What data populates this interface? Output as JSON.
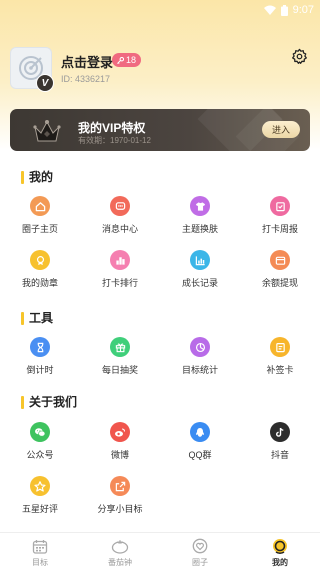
{
  "status_bar": {
    "time": "9:07"
  },
  "profile": {
    "login_label": "点击登录",
    "level": "18",
    "user_id": "ID: 4336217",
    "badge_letter": "V"
  },
  "vip": {
    "title": "我的VIP特权",
    "expiry": "有效期：1970-01-12",
    "enter_label": "进入"
  },
  "sections": {
    "mine": {
      "title": "我的",
      "items": [
        {
          "label": "圈子主页",
          "color": "#f39a55"
        },
        {
          "label": "消息中心",
          "color": "#f26a5a"
        },
        {
          "label": "主题换肤",
          "color": "#c06de6"
        },
        {
          "label": "打卡周报",
          "color": "#ef6aa0"
        },
        {
          "label": "我的勋章",
          "color": "#f7c12f"
        },
        {
          "label": "打卡排行",
          "color": "#f57fb0"
        },
        {
          "label": "成长记录",
          "color": "#3bb6e8"
        },
        {
          "label": "余额提现",
          "color": "#f48b55"
        }
      ]
    },
    "tools": {
      "title": "工具",
      "items": [
        {
          "label": "倒计时",
          "color": "#4a8ff2"
        },
        {
          "label": "每日抽奖",
          "color": "#3fcf7a"
        },
        {
          "label": "目标统计",
          "color": "#b86be8"
        },
        {
          "label": "补签卡",
          "color": "#f7b52c"
        }
      ]
    },
    "about": {
      "title": "关于我们",
      "items": [
        {
          "label": "公众号",
          "color": "#3ec35f"
        },
        {
          "label": "微博",
          "color": "#f0554d"
        },
        {
          "label": "QQ群",
          "color": "#3a8cf2"
        },
        {
          "label": "抖音",
          "color": "#2d2d2d"
        },
        {
          "label": "五星好评",
          "color": "#f7c12f"
        },
        {
          "label": "分享小目标",
          "color": "#f58a58"
        }
      ]
    }
  },
  "tabs": [
    {
      "label": "目标",
      "icon": "calendar-icon"
    },
    {
      "label": "番茄钟",
      "icon": "tomato-icon"
    },
    {
      "label": "圈子",
      "icon": "heart-circle-icon"
    },
    {
      "label": "我的",
      "icon": "profile-icon",
      "active": true
    }
  ]
}
